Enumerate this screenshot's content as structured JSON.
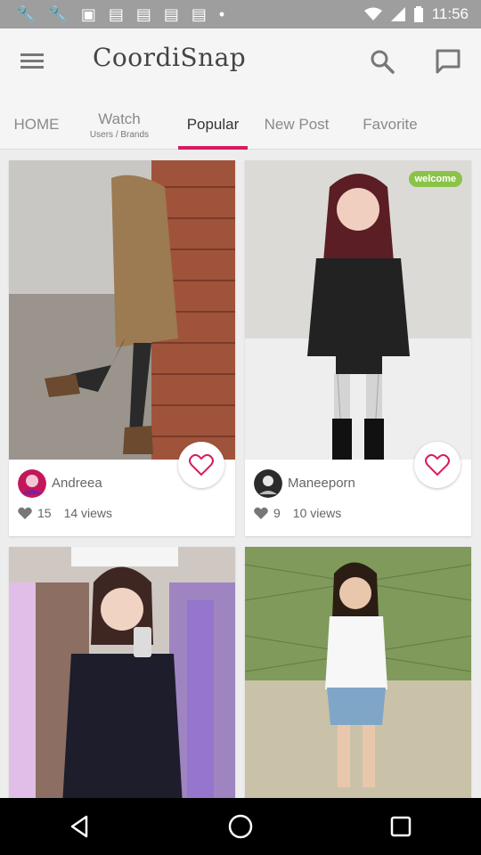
{
  "status_bar": {
    "time": "11:56",
    "icons": [
      "wrench-icon",
      "wrench-icon",
      "image-icon",
      "bag-icon",
      "bag-icon",
      "bag-icon",
      "bag-icon",
      "dot-icon"
    ]
  },
  "header": {
    "title": "CoordiSnap",
    "menu_icon": "hamburger-menu-icon",
    "search_icon": "search-icon",
    "message_icon": "message-icon"
  },
  "tabs": [
    {
      "label": "HOME",
      "sub": ""
    },
    {
      "label": "Watch",
      "sub": "Users / Brands"
    },
    {
      "label": "Popular",
      "sub": ""
    },
    {
      "label": "New Post",
      "sub": ""
    },
    {
      "label": "Favorite",
      "sub": ""
    }
  ],
  "active_tab": "Popular",
  "accent_color": "#d81b60",
  "badge_color": "#8bc34a",
  "posts": [
    {
      "username": "Andreea",
      "likes": "15",
      "views": "14 views",
      "badge": ""
    },
    {
      "username": "Maneeporn",
      "likes": "9",
      "views": "10 views",
      "badge": "welcome"
    },
    {
      "username": "",
      "likes": "",
      "views": "",
      "badge": ""
    },
    {
      "username": "",
      "likes": "",
      "views": "",
      "badge": ""
    }
  ],
  "nav": {
    "back": "back-icon",
    "home": "home-icon",
    "recents": "recents-icon"
  }
}
